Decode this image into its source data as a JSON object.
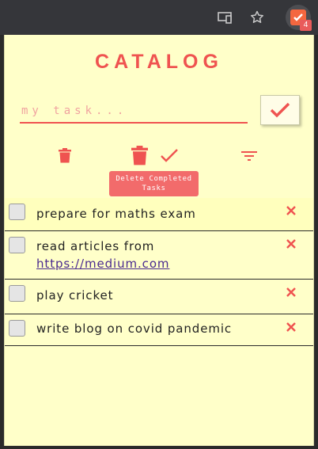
{
  "browser": {
    "extension_badge": "4",
    "cast_icon": "cast-icon",
    "star_icon": "star-icon"
  },
  "app": {
    "title": "CATALOG",
    "input_placeholder": "my task...",
    "input_value": "",
    "accent_color": "#ef5350",
    "background_color": "#ffffc9"
  },
  "actions": {
    "delete_all_icon": "trash-icon",
    "delete_completed_icon": "trash-icon",
    "complete_icon": "check-icon",
    "filter_icon": "filter-icon",
    "tooltip": "Delete Completed Tasks"
  },
  "tasks": [
    {
      "text": "prepare for maths exam",
      "link": "",
      "done": false
    },
    {
      "text": "read articles from",
      "link": "https://medium.com",
      "done": false
    },
    {
      "text": "play cricket",
      "link": "",
      "done": false
    },
    {
      "text": "write blog on covid pandemic",
      "link": "",
      "done": false
    }
  ]
}
